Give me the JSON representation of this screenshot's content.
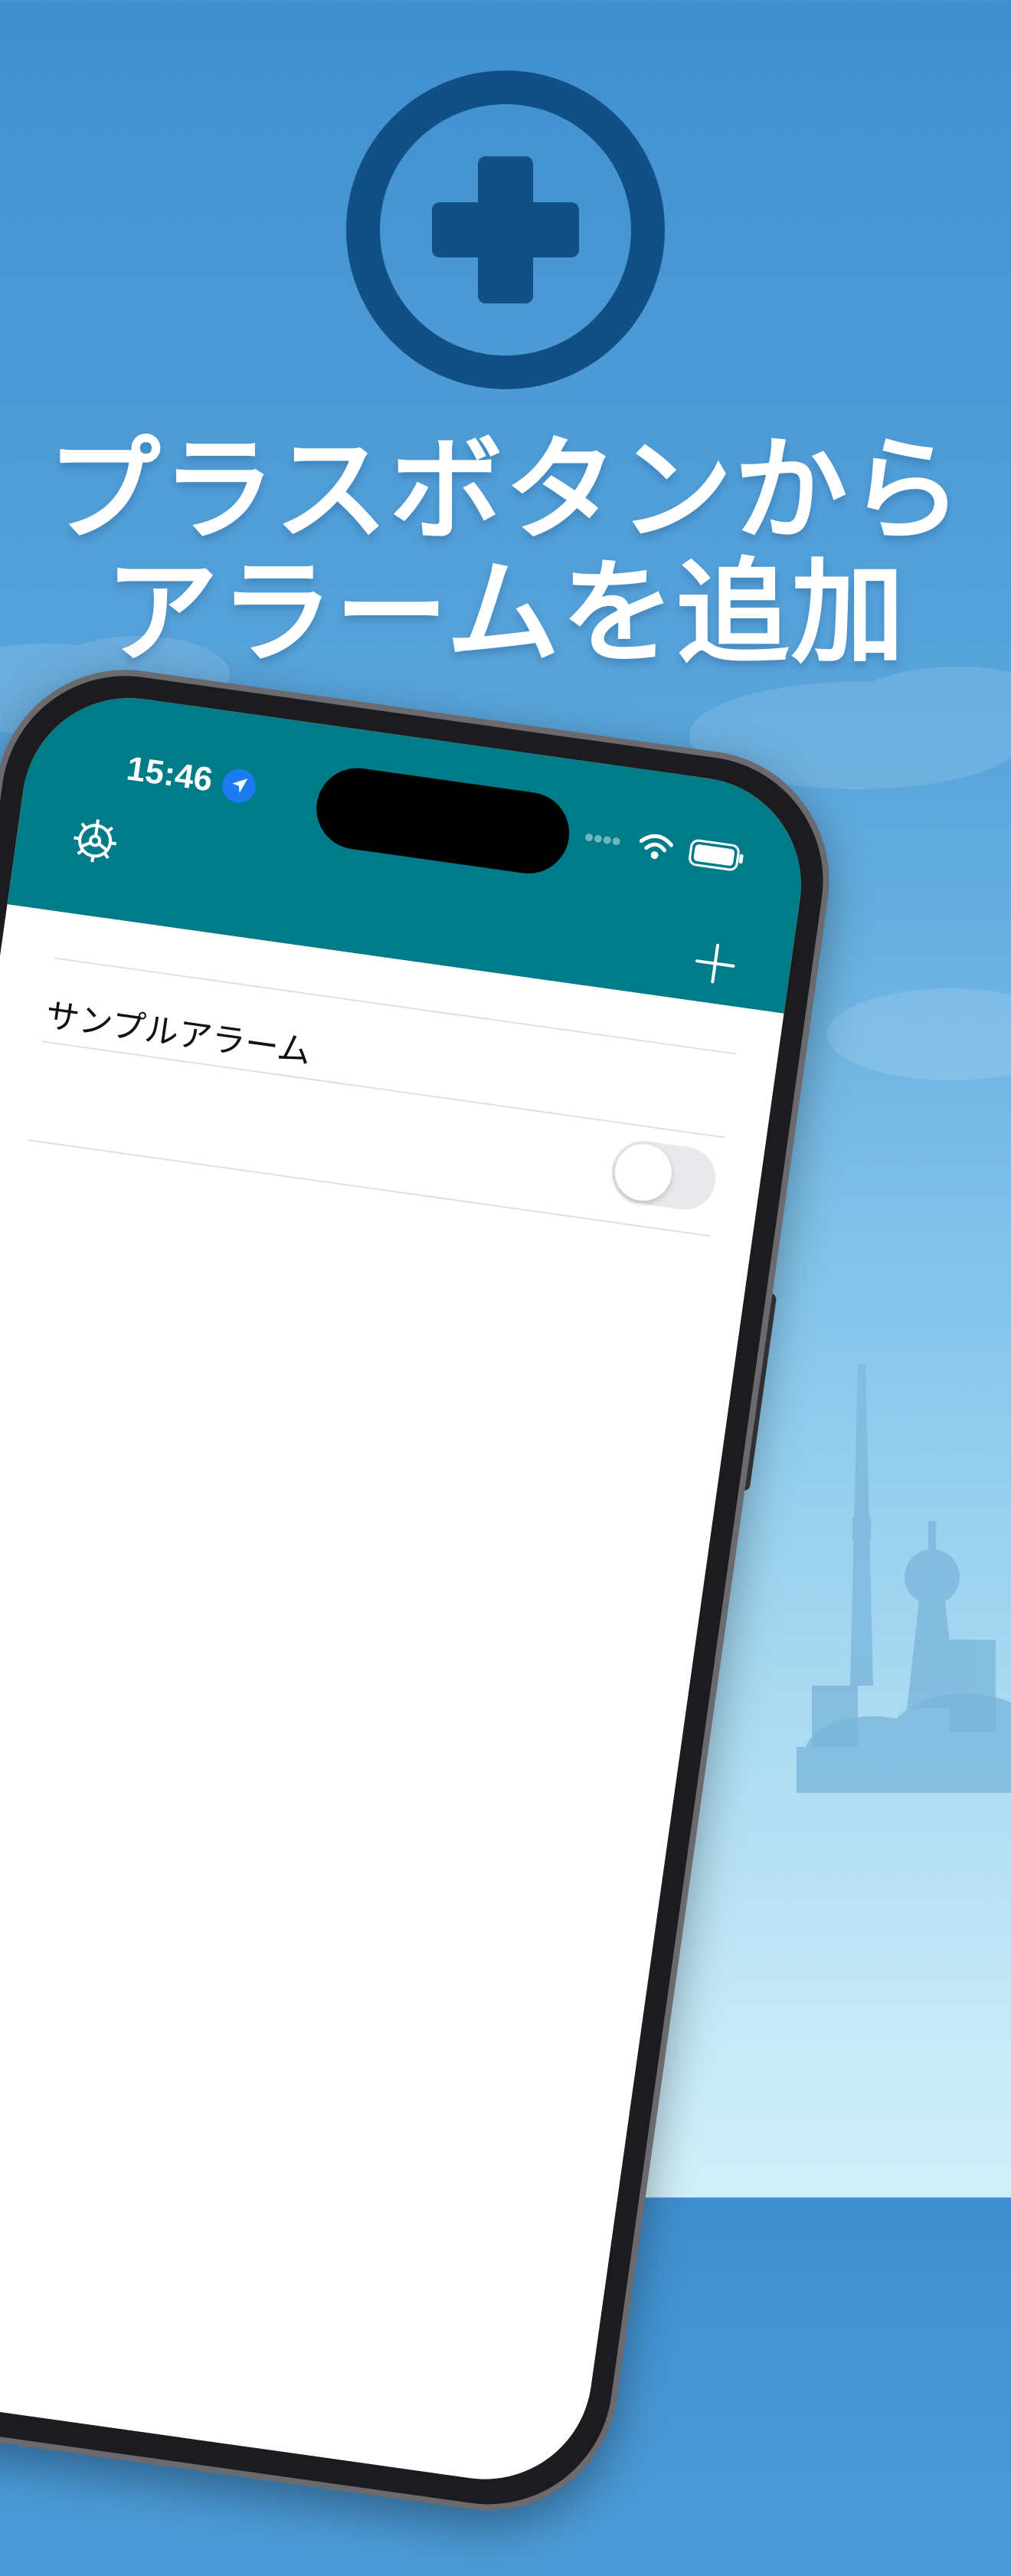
{
  "headline": {
    "line1": "プラスボタンから",
    "line2": "アラームを追加"
  },
  "icons": {
    "hero": "plus-circle-icon",
    "settings": "gear-icon",
    "add": "plus-icon",
    "location": "location-arrow-icon",
    "wifi": "wifi-icon",
    "battery": "battery-icon"
  },
  "status_bar": {
    "time": "15:46"
  },
  "alarms": [
    {
      "label": "サンプルアラーム",
      "enabled": false
    }
  ],
  "colors": {
    "sky_top": "#3f8fd0",
    "sky_bottom": "#d3f0fa",
    "hero_icon": "#134f87",
    "app_header": "#007b88",
    "location_badge": "#1a7cf0"
  }
}
